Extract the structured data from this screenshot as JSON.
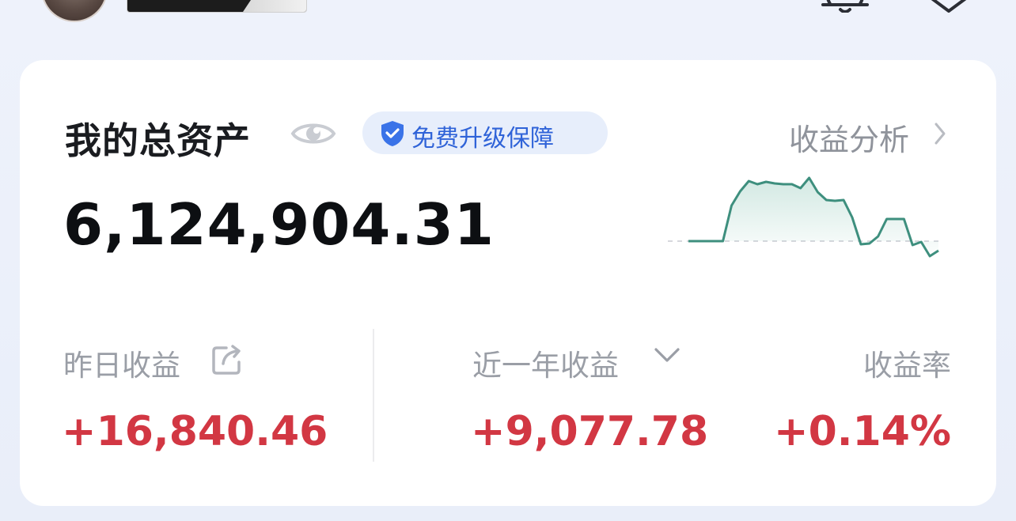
{
  "assets": {
    "title": "我的总资产",
    "badge_label": "免费升级保障",
    "analysis_link": "收益分析",
    "total_amount": "6,124,904.31",
    "sparkline_values": [
      0,
      0,
      0,
      0,
      0,
      0.45,
      0.63,
      0.76,
      0.72,
      0.75,
      0.73,
      0.72,
      0.72,
      0.67,
      0.8,
      0.62,
      0.52,
      0.51,
      0.52,
      0.3,
      -0.04,
      -0.03,
      0.06,
      0.28,
      0.28,
      0.28,
      -0.05,
      -0.01,
      -0.19,
      -0.12
    ]
  },
  "stats": {
    "yesterday_label": "昨日收益",
    "yesterday_value": "+16,840.46",
    "year_label": "近一年收益",
    "year_value": "+9,077.78",
    "rate_label": "收益率",
    "rate_value": "+0.14%"
  },
  "colors": {
    "accent_blue": "#2f63d8",
    "gain_red": "#d23743",
    "sparkline_green": "#3e8f7e"
  }
}
